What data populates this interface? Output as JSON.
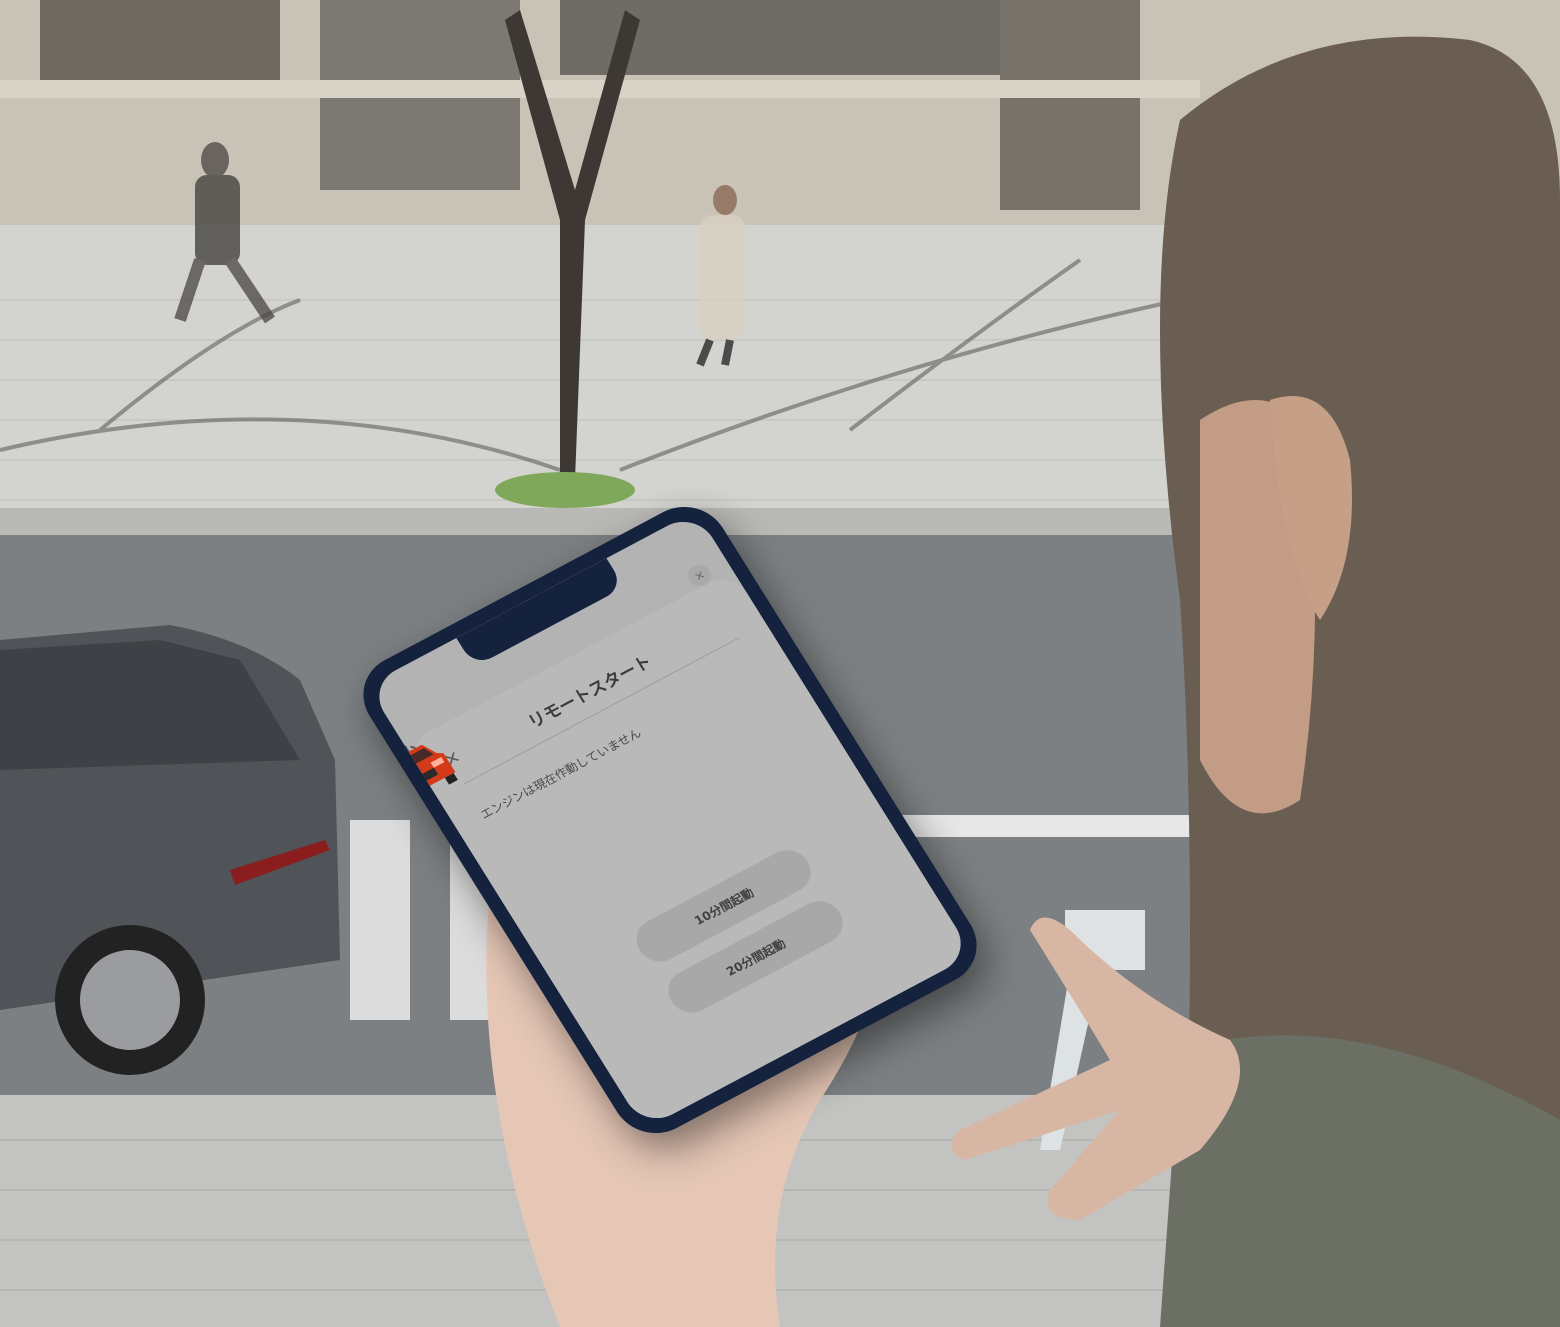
{
  "app": {
    "title": "リモートスタート",
    "close_label": "×",
    "top_close_label": "×",
    "status_text": "エンジンは現在作動していません",
    "power_icon": "power-icon",
    "car_icon": "car-icon",
    "buttons": [
      {
        "label": "10分間起動"
      },
      {
        "label": "20分間起動"
      }
    ]
  },
  "colors": {
    "phone_frame": "#14223e",
    "screen_bg": "#b9b9b9",
    "car_red": "#d23a1a",
    "button_bg": "#a8a8a8"
  }
}
